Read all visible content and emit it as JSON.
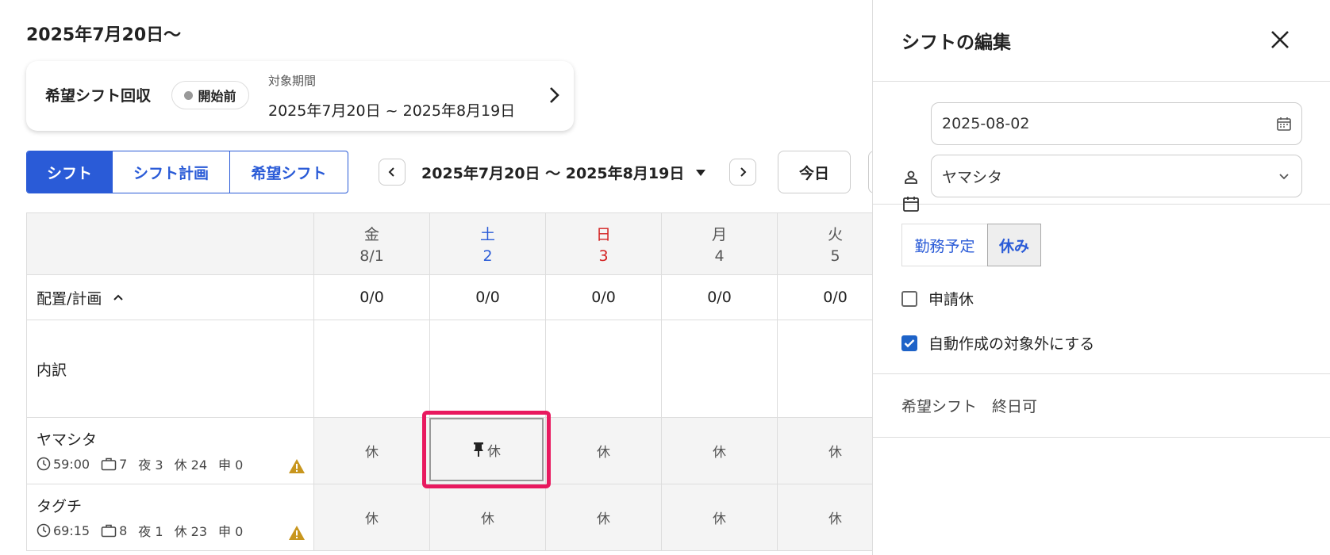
{
  "page": {
    "title": "2025年7月20日〜"
  },
  "collection_card": {
    "title": "希望シフト回収",
    "status": "開始前",
    "period_label": "対象期間",
    "period_range": "2025年7月20日 ~ 2025年8月19日"
  },
  "toolbar": {
    "tabs": [
      {
        "label": "シフト",
        "active": true
      },
      {
        "label": "シフト計画",
        "active": false
      },
      {
        "label": "希望シフト",
        "active": false
      }
    ],
    "range": "2025年7月20日 〜 2025年8月19日",
    "today": "今日"
  },
  "grid": {
    "days": [
      {
        "dow": "金",
        "date": "8/1",
        "kind": "weekday"
      },
      {
        "dow": "土",
        "date": "2",
        "kind": "sat"
      },
      {
        "dow": "日",
        "date": "3",
        "kind": "sun"
      },
      {
        "dow": "月",
        "date": "4",
        "kind": "weekday"
      },
      {
        "dow": "火",
        "date": "5",
        "kind": "weekday"
      }
    ],
    "placement_label": "配置/計画",
    "placement_values": [
      "0/0",
      "0/0",
      "0/0",
      "0/0",
      "0/0"
    ],
    "breakdown_label": "内訳",
    "people": [
      {
        "name": "ヤマシタ",
        "hours": "59:00",
        "work": "7",
        "night": "夜 3",
        "off": "休 24",
        "request": "申 0",
        "shifts": [
          "休",
          "休",
          "休",
          "休",
          "休"
        ]
      },
      {
        "name": "タグチ",
        "hours": "69:15",
        "work": "8",
        "night": "夜 1",
        "off": "休 23",
        "request": "申 0",
        "shifts": [
          "休",
          "休",
          "休",
          "休",
          "休"
        ]
      }
    ]
  },
  "panel": {
    "title": "シフトの編集",
    "date_value": "2025-08-02",
    "person_value": "ヤマシタ",
    "type_options": [
      "勤務予定",
      "休み"
    ],
    "type_selected": "休み",
    "request_leave_label": "申請休",
    "request_leave_checked": false,
    "exclude_auto_label": "自動作成の対象外にする",
    "exclude_auto_checked": true,
    "preferred_shift": "希望シフト　終日可"
  },
  "colors": {
    "accent": "#2a5bd7",
    "highlight": "#e8195f",
    "sunday": "#d32020",
    "warning": "#c8961e"
  }
}
